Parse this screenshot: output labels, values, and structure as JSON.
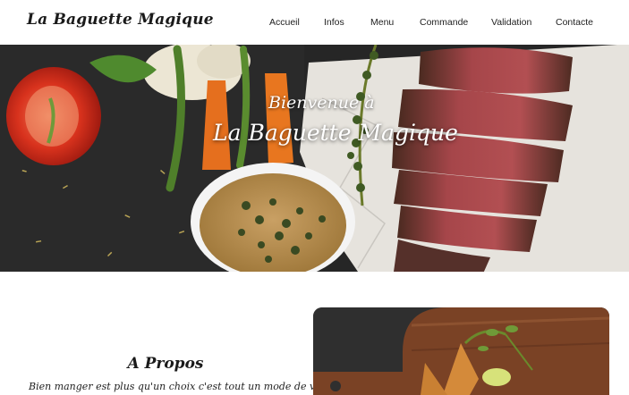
{
  "brand": {
    "logo_text": "La Baguette Magique"
  },
  "nav": {
    "items": [
      {
        "label": "Accueil"
      },
      {
        "label": "Infos"
      },
      {
        "label": "Menu"
      },
      {
        "label": "Commande"
      },
      {
        "label": "Validation"
      },
      {
        "label": "Contacte"
      }
    ]
  },
  "hero": {
    "welcome": "Bienvenue à",
    "title": "La Baguette Magique",
    "image": "steak-peppercorn-sauce-photo"
  },
  "about": {
    "title": "A Propos",
    "text": "Bien manger est plus qu'un choix c'est tout un mode de vie. la",
    "image": "cutting-board-food-photo"
  }
}
